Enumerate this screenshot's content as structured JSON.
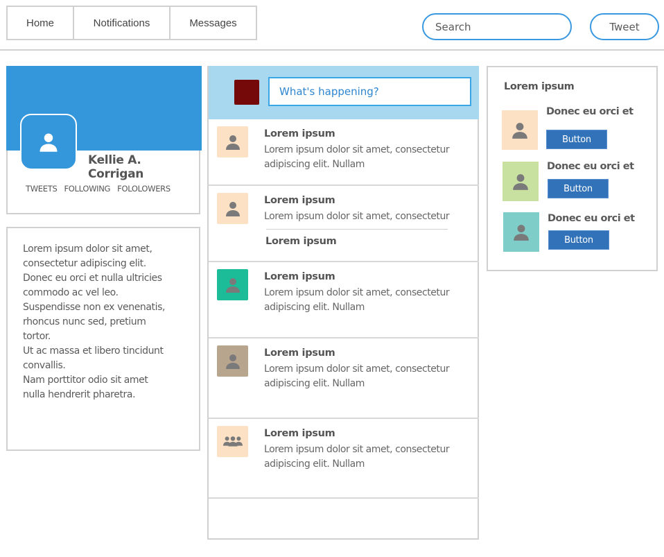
{
  "nav": {
    "items": [
      {
        "label": "Home"
      },
      {
        "label": "Notifications"
      },
      {
        "label": "Messages"
      }
    ],
    "search_placeholder": "Search",
    "tweet_label": "Tweet"
  },
  "colors": {
    "brand_blue": "#3496db",
    "accent_outline": "#3a98e0",
    "compose_bg": "#a8d8f0",
    "button_blue": "#3272b8"
  },
  "profile": {
    "avatar_icon": "user-icon",
    "name": "Kellie A. Corrigan",
    "stats": [
      "TWEETS",
      "FOLLOWING",
      "FOLOLOWERS"
    ]
  },
  "bio": {
    "lines": [
      "Lorem ipsum dolor sit amet,",
      "consectetur adipiscing elit.",
      "Donec eu orci et nulla ultricies",
      "commodo ac vel leo.",
      "Suspendisse non ex venenatis,",
      "rhoncus nunc sed, pretium",
      "tortor.",
      "Ut ac massa et libero tincidunt",
      "convallis.",
      "Nam porttitor odio sit amet",
      "nulla hendrerit pharetra."
    ]
  },
  "compose": {
    "avatar_color": "#750808",
    "placeholder": "What's happening?"
  },
  "feed": {
    "posts": [
      {
        "title": "Lorem ipsum",
        "text": "Lorem ipsum dolor sit amet, consectetur adipiscing elit. Nullam",
        "avatar_color": "#fde1c4",
        "icon": "user-icon"
      },
      {
        "title": "Lorem ipsum",
        "text": "Lorem ipsum dolor sit amet, consectetur",
        "sub_title": "Lorem ipsum",
        "avatar_color": "#fde1c4",
        "icon": "user-icon"
      },
      {
        "title": "Lorem ipsum",
        "text": "Lorem ipsum dolor sit amet, consectetur adipiscing elit. Nullam",
        "avatar_color": "#1dbc98",
        "icon": "user-icon"
      },
      {
        "title": "Lorem ipsum",
        "text": "Lorem ipsum dolor sit amet, consectetur adipiscing elit. Nullam",
        "avatar_color": "#b8a58e",
        "icon": "user-icon"
      },
      {
        "title": "Lorem ipsum",
        "text": "Lorem ipsum dolor sit amet, consectetur adipiscing elit. Nullam",
        "avatar_color": "#fde1c4",
        "icon": "group-icon"
      }
    ]
  },
  "suggestions": {
    "title": "Lorem ipsum",
    "items": [
      {
        "name": "Donec eu orci et",
        "button_label": "Button",
        "avatar_color": "#fde1c4"
      },
      {
        "name": "Donec eu orci et",
        "button_label": "Button",
        "avatar_color": "#c8e0a0"
      },
      {
        "name": "Donec eu orci et",
        "button_label": "Button",
        "avatar_color": "#7ecdc8"
      }
    ]
  }
}
